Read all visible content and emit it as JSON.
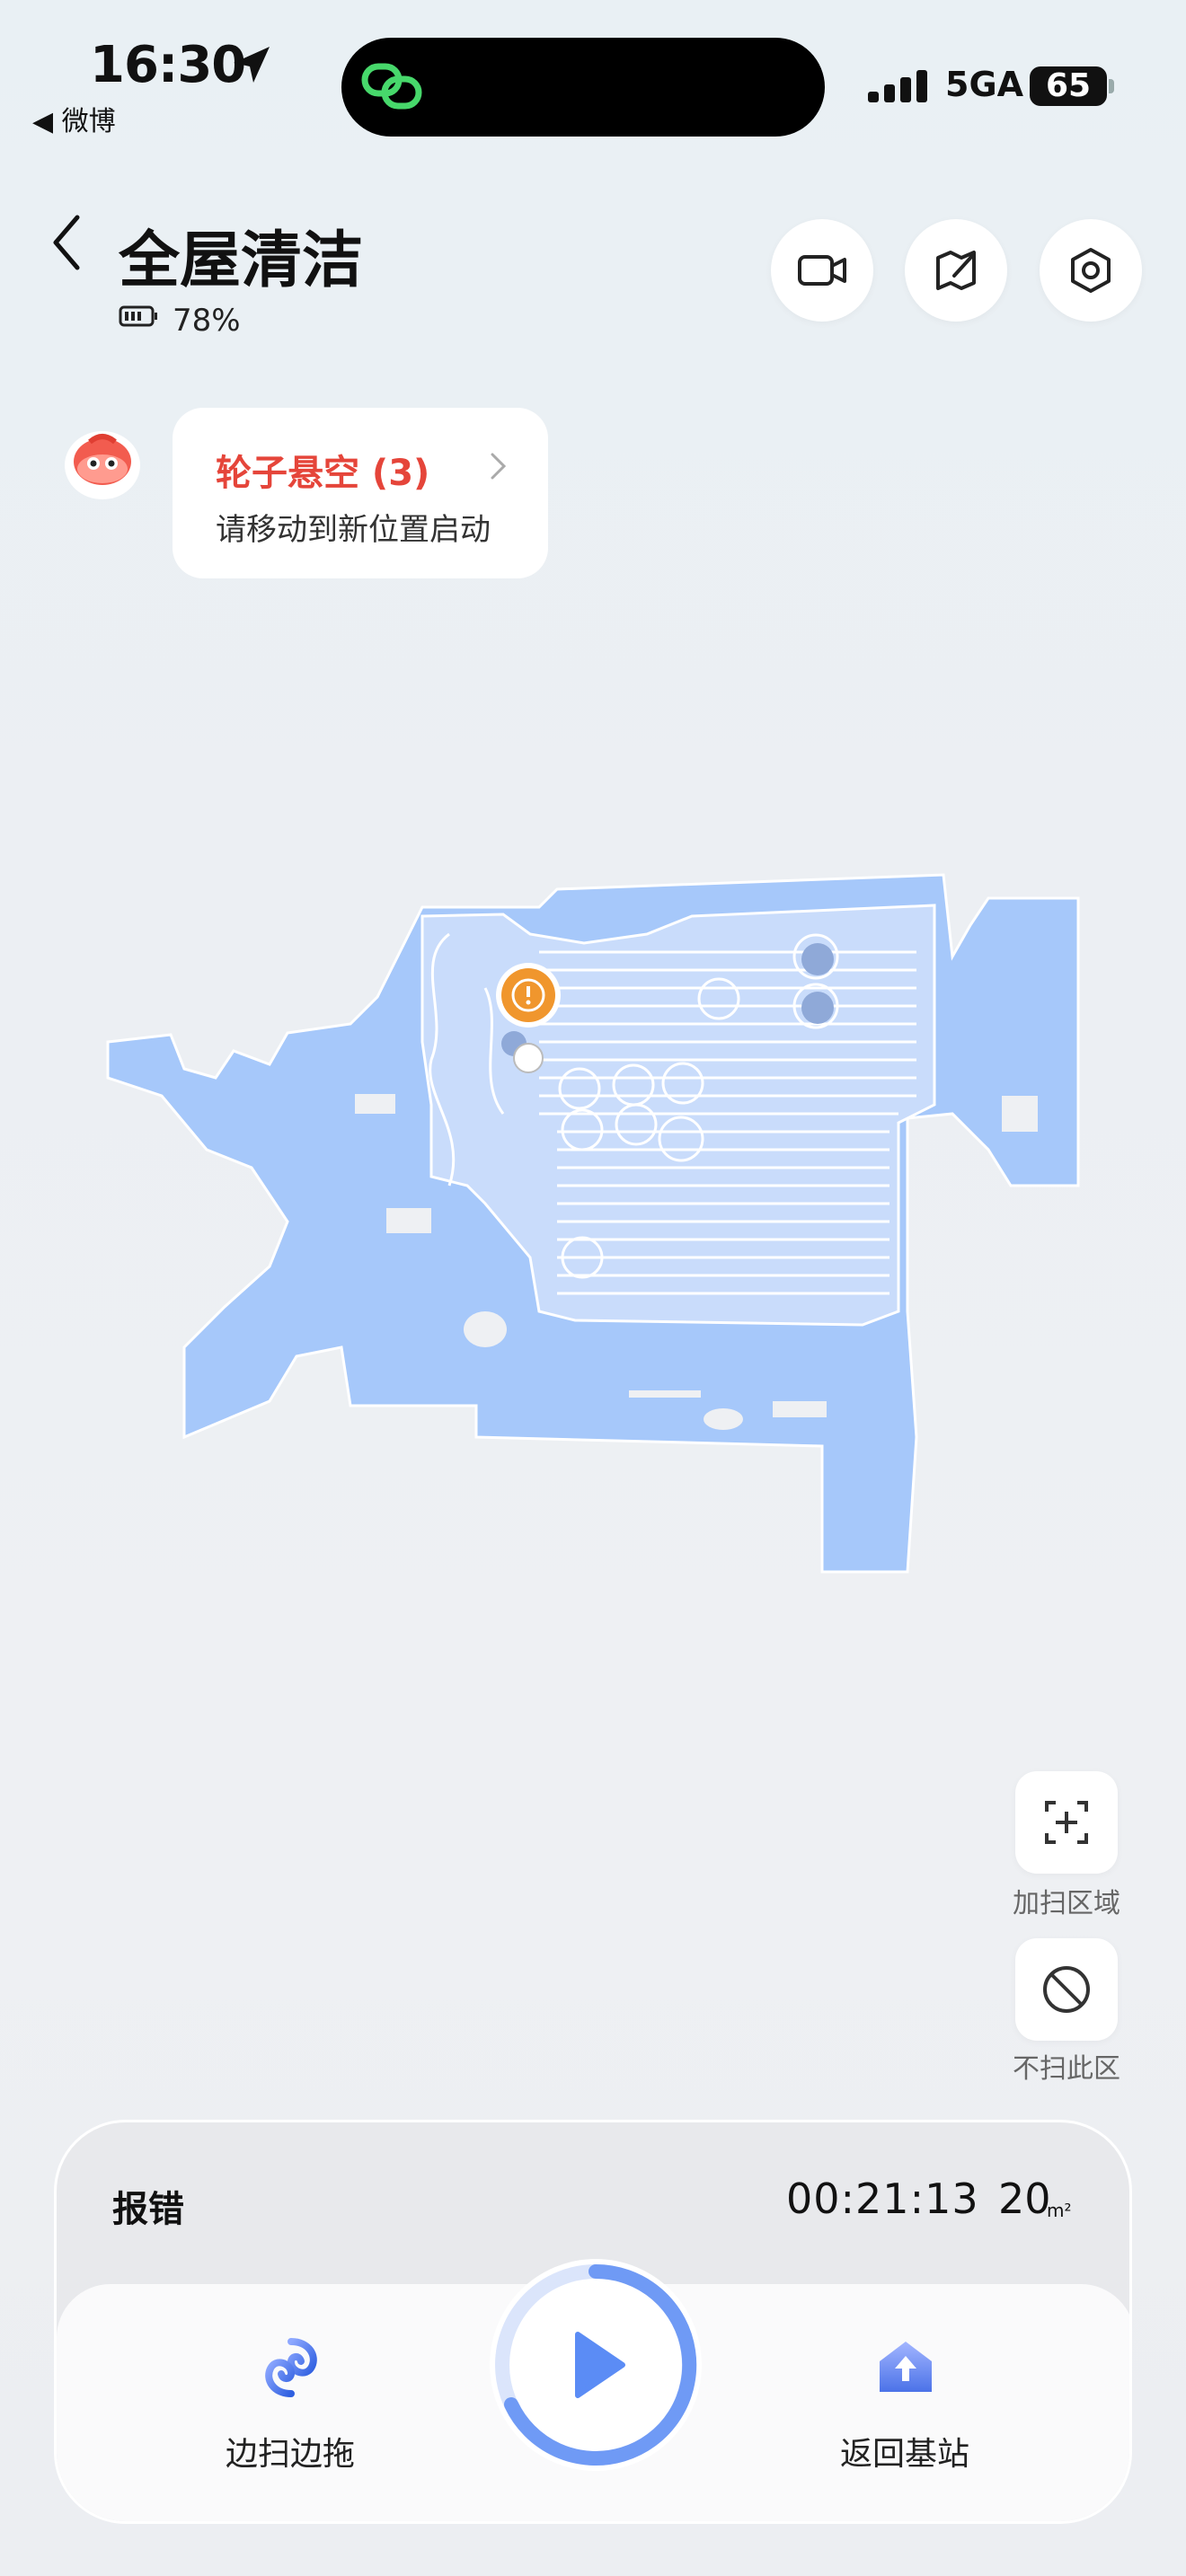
{
  "status_bar": {
    "time": "16:30",
    "back_app": "◀ 微博",
    "network": "5GA",
    "battery": "65"
  },
  "header": {
    "title": "全屋清洁",
    "device_battery": "78%",
    "actions": [
      "video-icon",
      "edit-map-icon",
      "settings-icon"
    ]
  },
  "alert": {
    "title": "轮子悬空 (3)",
    "message": "请移动到新位置启动"
  },
  "tools": {
    "add_area": "加扫区域",
    "no_go": "不扫此区"
  },
  "panel": {
    "error_label": "报错",
    "elapsed": "00:21:13",
    "area_value": "20",
    "area_unit": "m²",
    "mode_label": "边扫边拖",
    "return_label": "返回基站",
    "play_icon": "play-icon"
  },
  "colors": {
    "map_fill": "#a6c8fa",
    "path": "#ffffff",
    "alert_red": "#e5453a",
    "warning_orange": "#f0962d",
    "accent_blue": "#5b8cf5"
  }
}
